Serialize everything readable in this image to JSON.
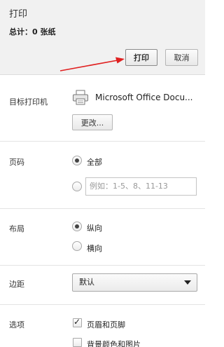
{
  "header": {
    "title": "打印",
    "summary": "总计：0 张纸",
    "print_label": "打印",
    "cancel_label": "取消"
  },
  "destination": {
    "label": "目标打印机",
    "printer_name": "Microsoft Office Docu...",
    "change_label": "更改..."
  },
  "pages": {
    "label": "页码",
    "all_label": "全部",
    "all_selected": true,
    "range_placeholder": "例如：1-5、8、11-13"
  },
  "layout": {
    "label": "布局",
    "portrait_label": "纵向",
    "portrait_selected": true,
    "landscape_label": "横向"
  },
  "margins": {
    "label": "边距",
    "value": "默认"
  },
  "options": {
    "label": "选项",
    "headers_footers_label": "页眉和页脚",
    "headers_footers_checked": true,
    "background_label": "背景颜色和图片",
    "background_checked": false
  },
  "colors": {
    "annotation_arrow": "#e02020"
  }
}
